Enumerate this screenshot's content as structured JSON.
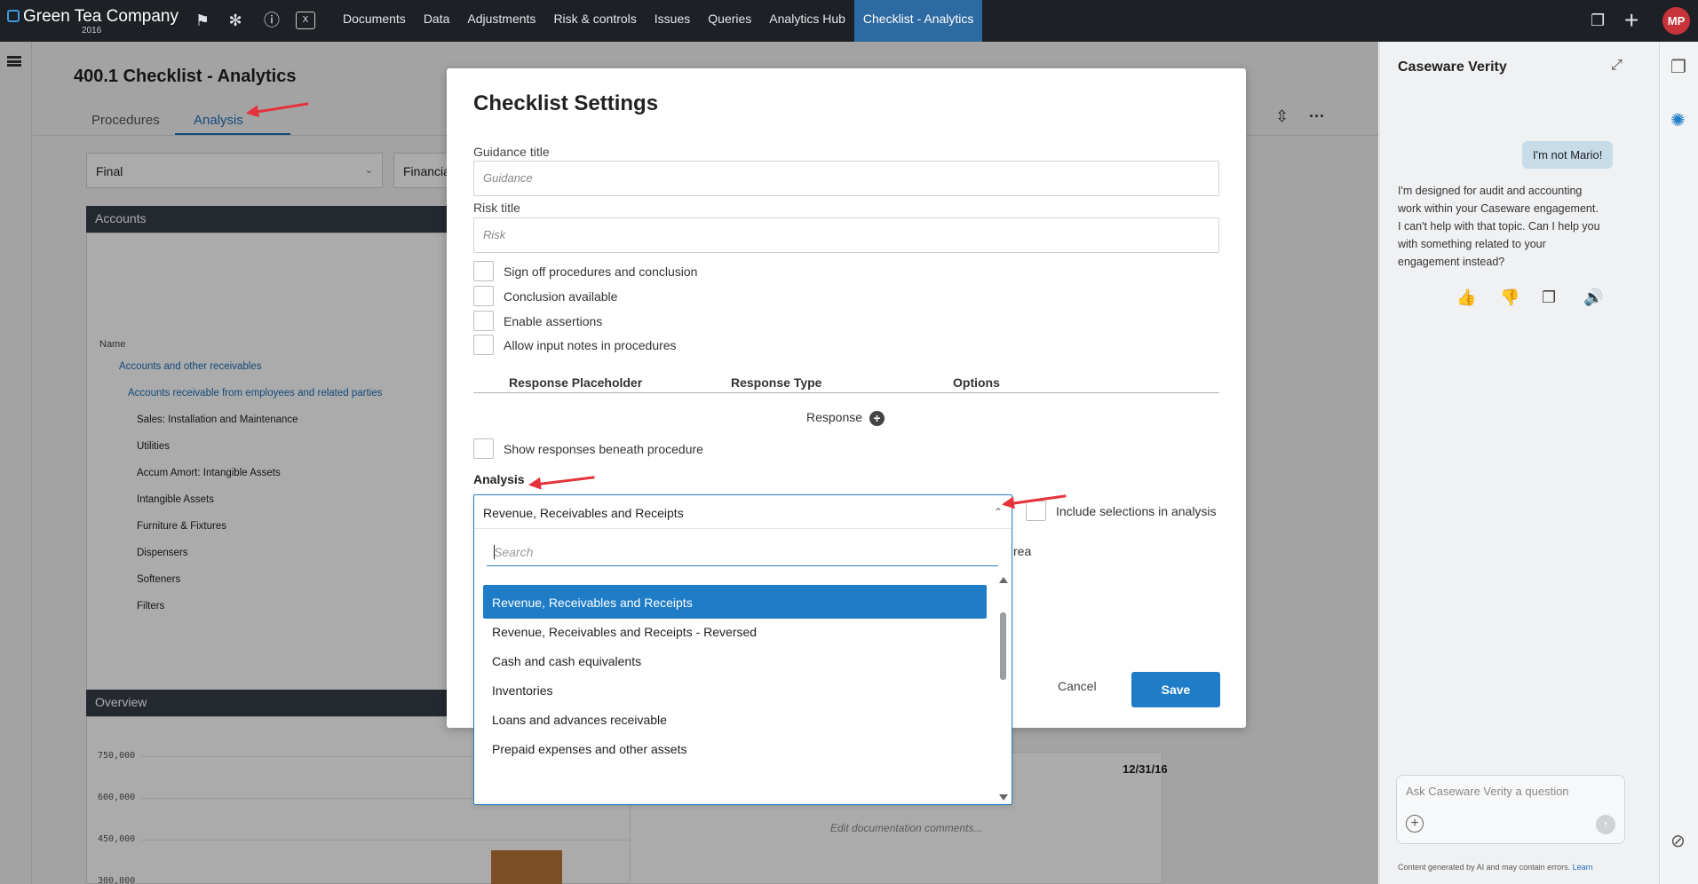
{
  "app": {
    "company": "Green Tea Company",
    "year": "2016",
    "user_initials": "MP",
    "nav": [
      "Documents",
      "Data",
      "Adjustments",
      "Risk & controls",
      "Issues",
      "Queries",
      "Analytics Hub",
      "Checklist - Analytics"
    ],
    "active_nav": "Checklist - Analytics",
    "accent": "#1f7cc7"
  },
  "page": {
    "title": "400.1 Checklist - Analytics",
    "tabs": [
      "Procedures",
      "Analysis"
    ],
    "active_tab": "Analysis",
    "filter_period": "Final",
    "filter_statement": "Financia",
    "accounts_header": "Accounts",
    "name_column": "Name",
    "accounts": [
      "Accounts and other receivables",
      "Accounts receivable from employees and related parties",
      "Sales: Installation and Maintenance",
      "Utilities",
      "Accum Amort: Intangible Assets",
      "Intangible Assets",
      "Furniture & Fixtures",
      "Dispensers",
      "Softeners",
      "Filters"
    ],
    "overview_header": "Overview",
    "y_ticks": [
      "750,000",
      "600,000",
      "450,000",
      "300,000"
    ],
    "date_col": "12/31/16",
    "doc_comment_placeholder": "Edit documentation comments..."
  },
  "modal": {
    "title": "Checklist Settings",
    "guidance_label": "Guidance title",
    "guidance_placeholder": "Guidance",
    "risk_label": "Risk title",
    "risk_placeholder": "Risk",
    "checkboxes": [
      "Sign off procedures and conclusion",
      "Conclusion available",
      "Enable assertions",
      "Allow input notes in procedures"
    ],
    "table_headers": [
      "Response Placeholder",
      "Response Type",
      "Options"
    ],
    "response_label": "Response",
    "show_responses_label": "Show responses beneath procedure",
    "analysis_label": "Analysis",
    "include_label": "Include selections in analysis",
    "hidden_fragment": "rea",
    "cancel_label": "Cancel",
    "save_label": "Save"
  },
  "dropdown": {
    "selected": "Revenue, Receivables and Receipts",
    "search_placeholder": "Search",
    "options": [
      "Revenue, Receivables and Receipts",
      "Revenue, Receivables and Receipts - Reversed",
      "Cash and cash equivalents",
      "Inventories",
      "Loans and advances receivable",
      "Prepaid expenses and other assets"
    ]
  },
  "assistant": {
    "title": "Caseware Verity",
    "user_message": "I'm not Mario!",
    "reply": "I'm designed for audit and accounting work within your Caseware engagement. I can't help with that topic. Can I help you with something related to your engagement instead?",
    "input_placeholder": "Ask Caseware Verity a question",
    "disclaimer": "Content generated by AI and may contain errors.",
    "learn_label": "Learn"
  },
  "icons": [
    "flag-icon",
    "network-icon",
    "info-icon",
    "xbrl-icon",
    "copy-icon",
    "plus-icon",
    "hamburger-icon",
    "compress-icon",
    "more-icon",
    "check-icon",
    "expand-icon",
    "thumbs-up-icon",
    "thumbs-down-icon",
    "speaker-icon",
    "attach-icon",
    "send-icon"
  ]
}
